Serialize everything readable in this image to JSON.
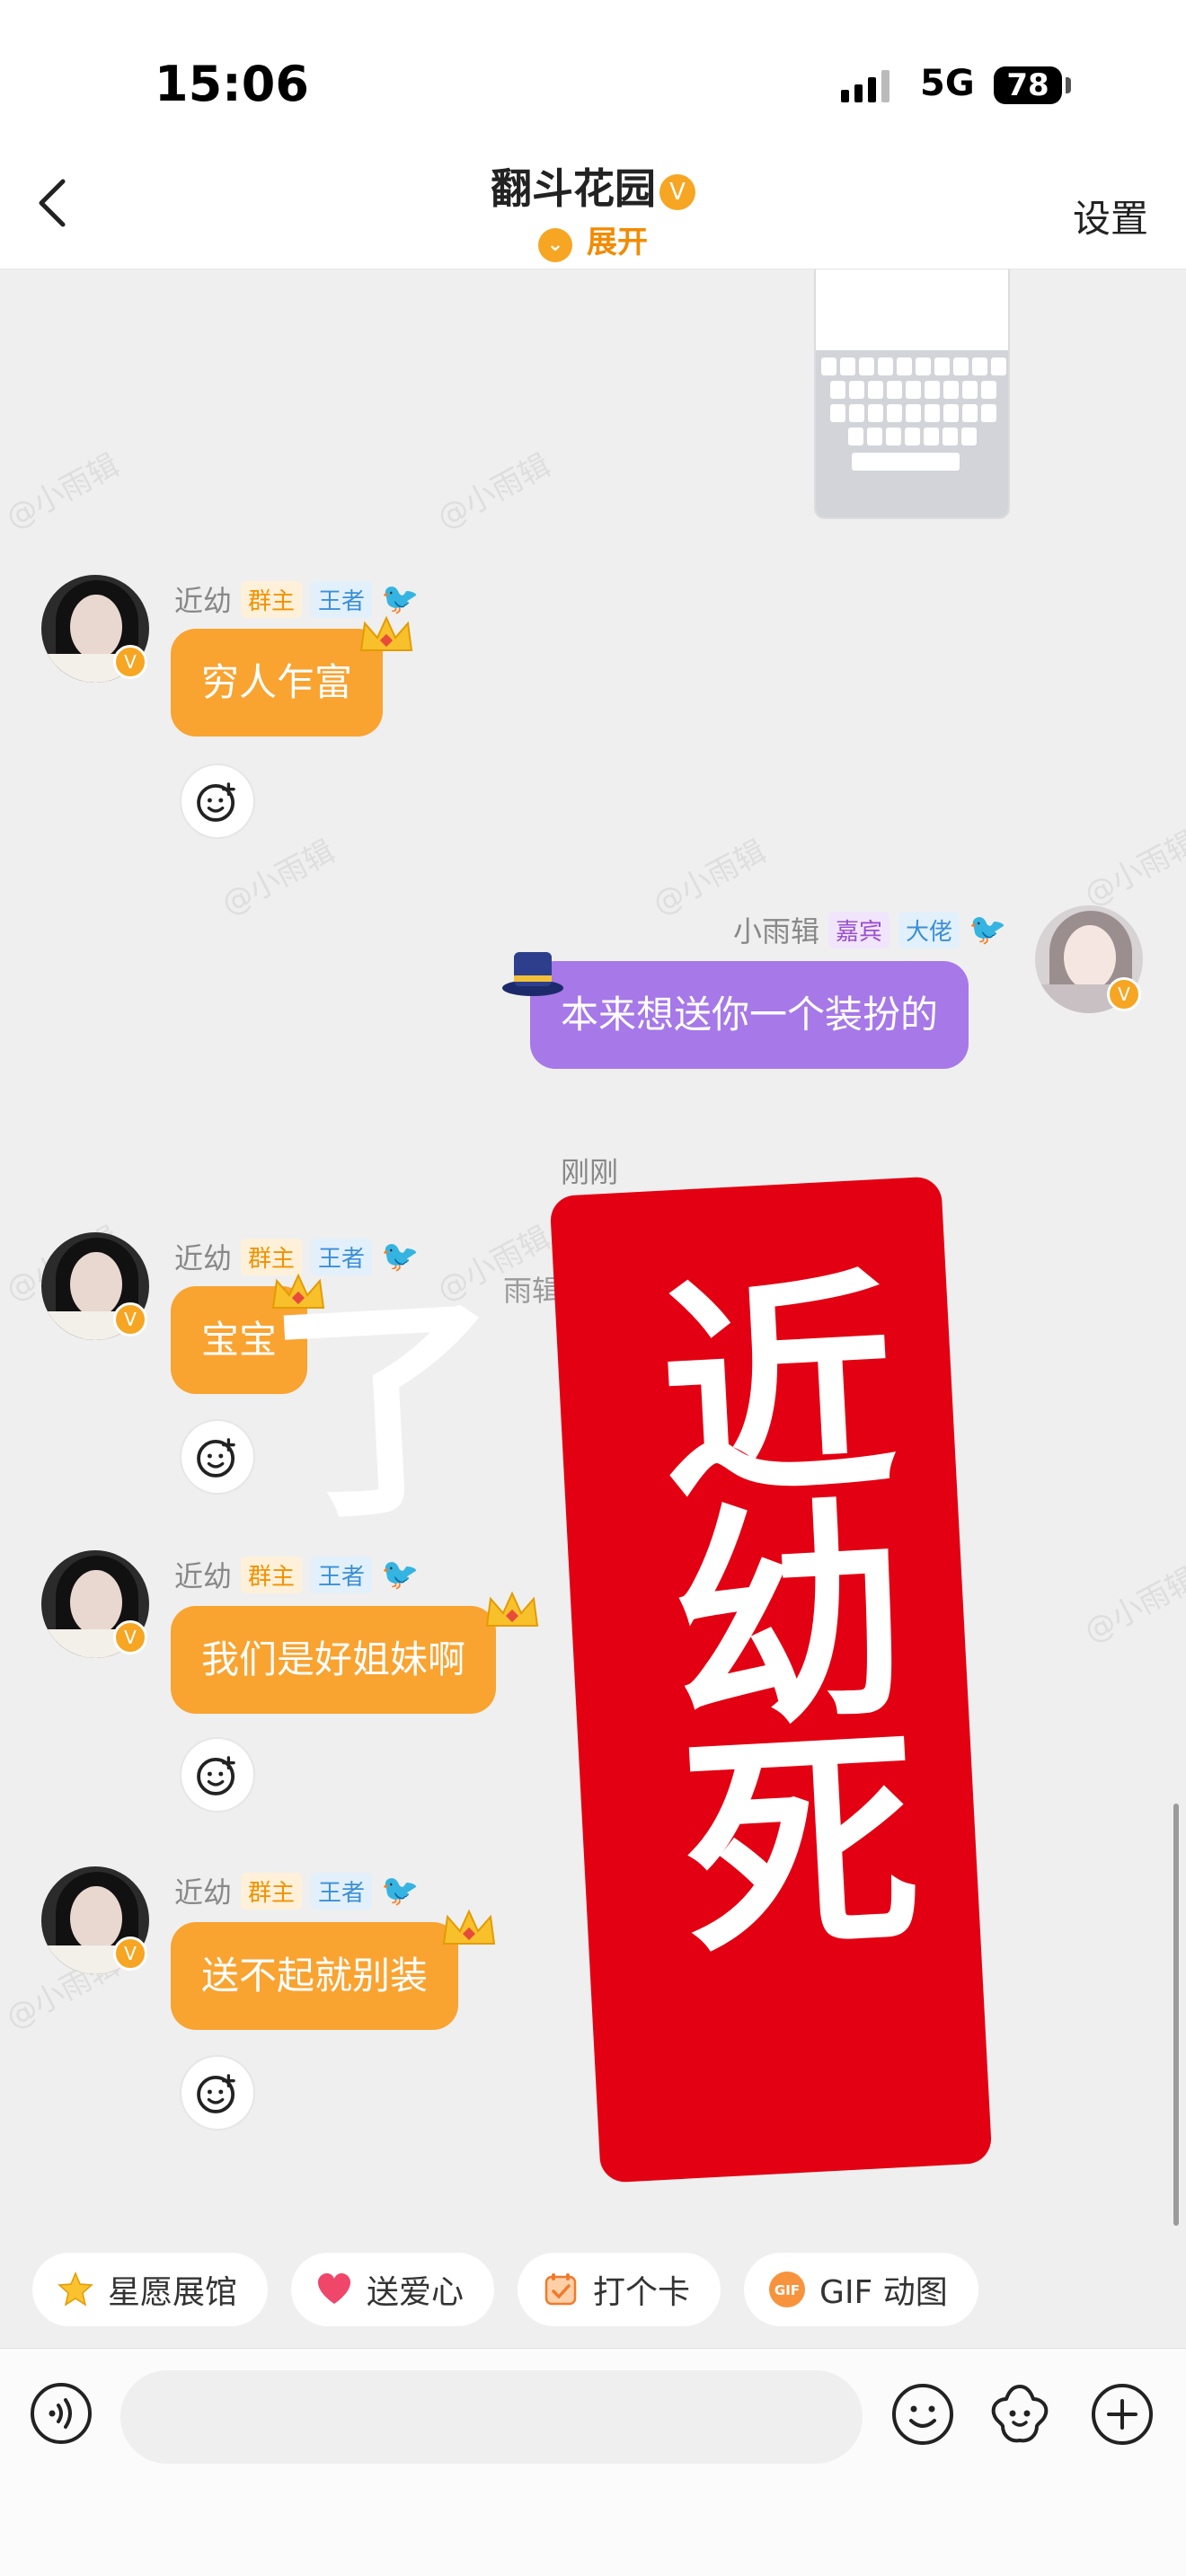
{
  "status_bar": {
    "time": "15:06",
    "network": "5G",
    "battery": "78"
  },
  "header": {
    "title": "翻斗花园",
    "expand_label": "展开",
    "settings_label": "设置"
  },
  "watermark": "@小雨辑",
  "messages": [
    {
      "sender": "近幼",
      "tags": [
        "群主",
        "王者"
      ],
      "text": "穷人乍富"
    },
    {
      "sender": "小雨辑",
      "tags": [
        "嘉宾",
        "大佬"
      ],
      "text": "本来想送你一个装扮的"
    },
    {
      "sender": "近幼",
      "tags": [
        "群主",
        "王者"
      ],
      "text": "宝宝"
    },
    {
      "sender": "近幼",
      "tags": [
        "群主",
        "王者"
      ],
      "text": "我们是好姐妹啊"
    },
    {
      "sender": "近幼",
      "tags": [
        "群主",
        "王者"
      ],
      "text": "送不起就别装"
    }
  ],
  "timestamp": "刚刚",
  "sticker": {
    "text": "近幼死了",
    "partial_label": "雨辑",
    "color": "#e30012"
  },
  "quick_actions": [
    "星愿展馆",
    "送爱心",
    "打个卡",
    "GIF 动图"
  ],
  "colors": {
    "accent": "#f6a623",
    "bubble_self": "#a678e8",
    "bubble_other": "#f9a331"
  }
}
